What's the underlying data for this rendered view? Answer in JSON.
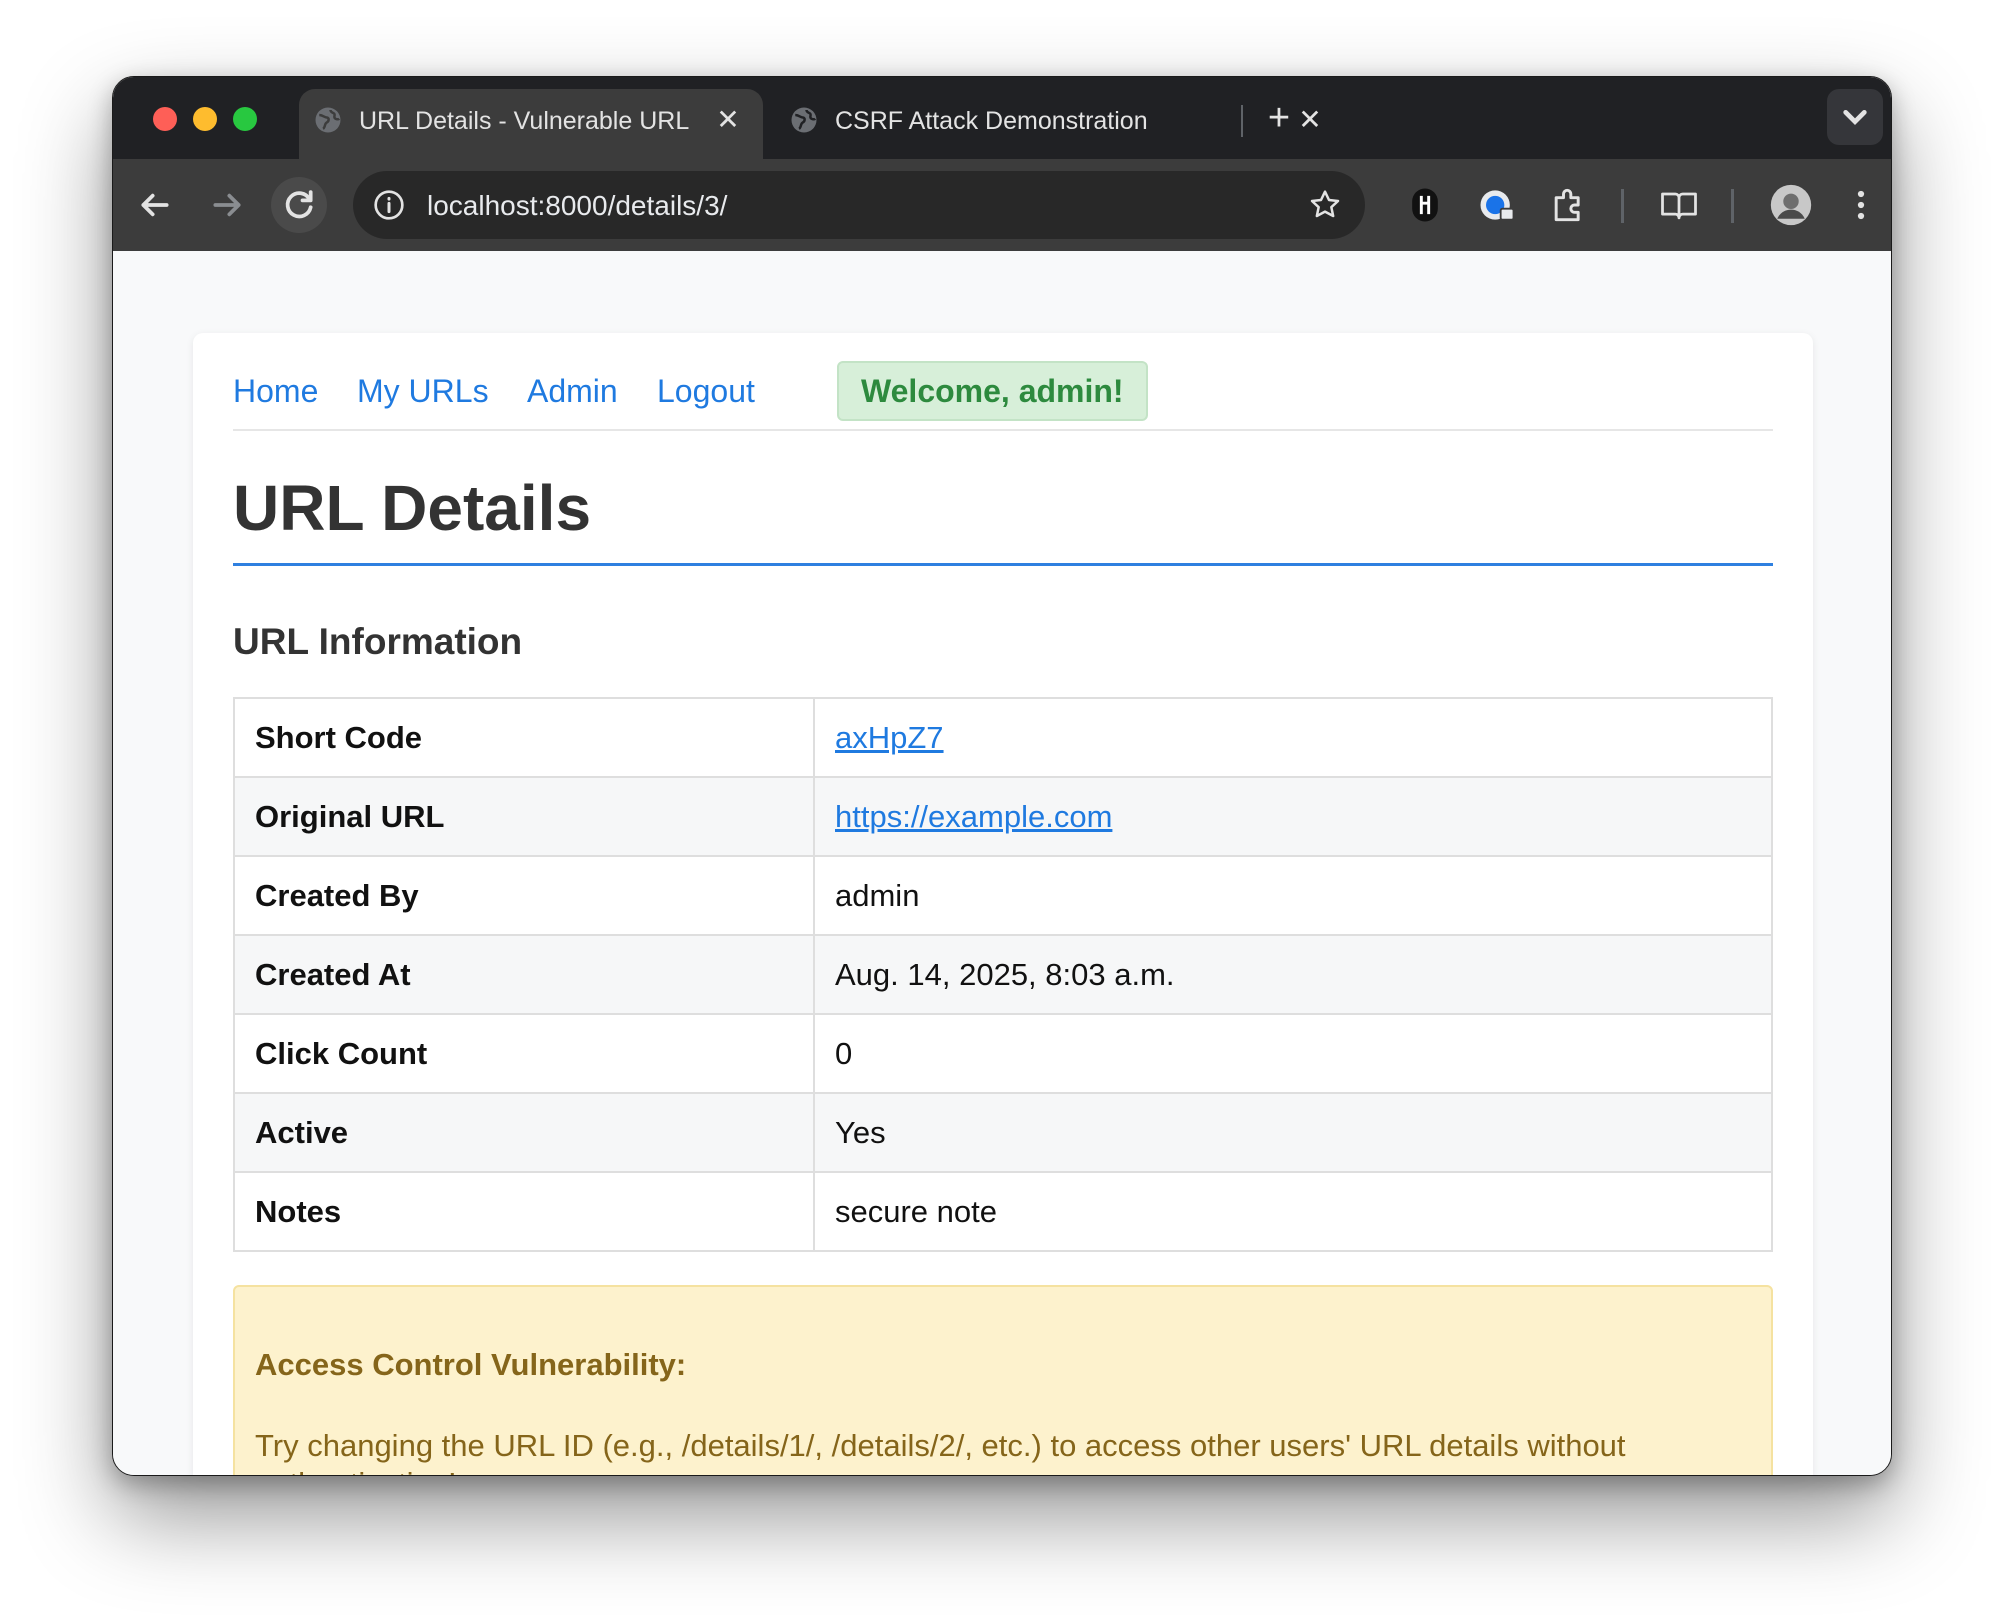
{
  "browser": {
    "tabs": [
      {
        "title": "URL Details - Vulnerable URL",
        "active": true
      },
      {
        "title": "CSRF Attack Demonstration",
        "active": false
      }
    ],
    "address": "localhost:8000/details/3/"
  },
  "nav": {
    "home": "Home",
    "my_urls": "My URLs",
    "admin": "Admin",
    "logout": "Logout",
    "welcome": "Welcome, admin!"
  },
  "page": {
    "title": "URL Details",
    "section_title": "URL Information"
  },
  "details": {
    "rows": [
      {
        "label": "Short Code",
        "value": "axHpZ7"
      },
      {
        "label": "Original URL",
        "value": "https://example.com"
      },
      {
        "label": "Created By",
        "value": "admin"
      },
      {
        "label": "Created At",
        "value": "Aug. 14, 2025, 8:03 a.m."
      },
      {
        "label": "Click Count",
        "value": "0"
      },
      {
        "label": "Active",
        "value": "Yes"
      },
      {
        "label": "Notes",
        "value": "secure note"
      }
    ]
  },
  "alert": {
    "title": "Access Control Vulnerability:",
    "body": "Try changing the URL ID (e.g., /details/1/, /details/2/, etc.) to access other users' URL details without authentication!"
  },
  "colors": {
    "link": "#1f7ae0",
    "accent_rule": "#2f80e0",
    "welcome_bg": "#d7efd9",
    "welcome_text": "#2d8a3e",
    "alert_bg": "#fdf2cd",
    "alert_text": "#85651a"
  }
}
